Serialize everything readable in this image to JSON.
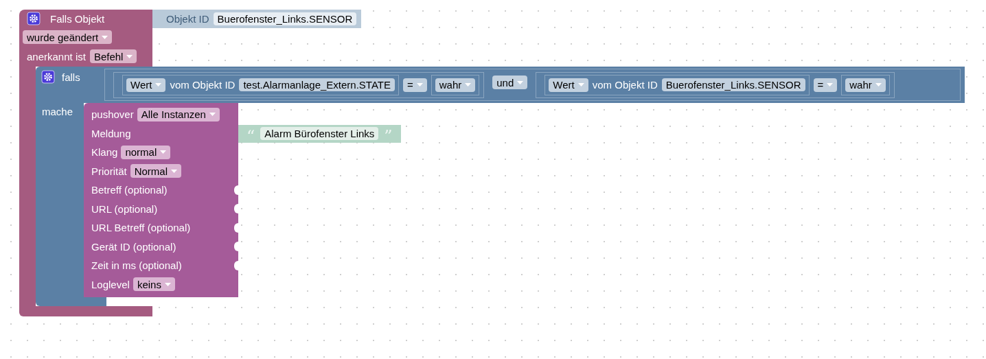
{
  "trigger": {
    "title": "Falls Objekt",
    "object_input": {
      "label": "Objekt ID",
      "value": "Buerofenster_Links.SENSOR"
    },
    "event": "wurde geändert",
    "ack_label": "anerkannt ist",
    "ack": "Befehl"
  },
  "if_block": {
    "title": "falls",
    "condition": {
      "operator": "und",
      "operands": [
        {
          "property": "Wert",
          "label": "vom Objekt ID",
          "object_id": "test.Alarmanlage_Extern.STATE",
          "comparator": "=",
          "value": "wahr"
        },
        {
          "property": "Wert",
          "label": "vom Objekt ID",
          "object_id": "Buerofenster_Links.SENSOR",
          "comparator": "=",
          "value": "wahr"
        }
      ]
    },
    "do_label": "mache"
  },
  "pushover": {
    "title": "pushover",
    "instance": "Alle Instanzen",
    "rows": [
      {
        "kind": "input",
        "label": "Meldung",
        "text": "Alarm Bürofenster Links",
        "quote_open": "“",
        "quote_close": "”"
      },
      {
        "kind": "dropdown",
        "label": "Klang",
        "value": "normal"
      },
      {
        "kind": "dropdown",
        "label": "Priorität",
        "value": "Normal"
      },
      {
        "kind": "input",
        "label": "Betreff (optional)"
      },
      {
        "kind": "input",
        "label": "URL (optional)"
      },
      {
        "kind": "input",
        "label": "URL Betreff (optional)"
      },
      {
        "kind": "input",
        "label": "Gerät ID (optional)"
      },
      {
        "kind": "input",
        "label": "Zeit in ms (optional)"
      },
      {
        "kind": "dropdown",
        "label": "Loglevel",
        "value": "keins"
      }
    ]
  }
}
